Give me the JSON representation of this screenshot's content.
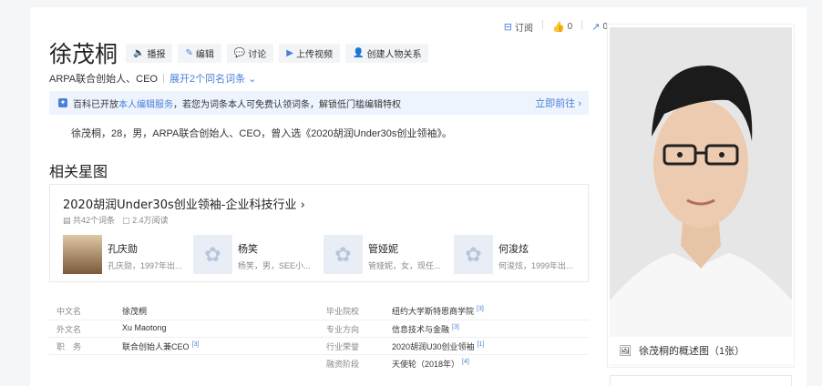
{
  "topbar": {
    "subscribe": "订阅",
    "likes": "0",
    "shares": "0"
  },
  "entry": {
    "title": "徐茂桐",
    "subtitle": "ARPA联合创始人、CEO",
    "more_meanings": "展开2个同名词条"
  },
  "actions": [
    {
      "icon": "speaker-icon",
      "glyph": "🔈",
      "label": "播报"
    },
    {
      "icon": "edit-icon",
      "glyph": "✎",
      "label": "编辑"
    },
    {
      "icon": "discuss-icon",
      "glyph": "💬",
      "label": "讨论"
    },
    {
      "icon": "video-icon",
      "glyph": "▶",
      "label": "上传视频"
    },
    {
      "icon": "relation-icon",
      "glyph": "👤",
      "label": "创建人物关系"
    }
  ],
  "notice": {
    "prefix": "百科已开放",
    "link": "本人编辑服务",
    "text": "，若您为词条本人可免费认领词条，解锁低门槛编辑特权",
    "action": "立即前往 ›"
  },
  "summary": "徐茂桐，28，男，ARPA联合创始人、CEO，曾入选《2020胡润Under30s创业领袖》。",
  "star_section": {
    "heading": "相关星图",
    "title": "2020胡润Under30s创业领袖-企业科技行业 ›",
    "entries": "共42个词条",
    "reads": "2.4万阅读",
    "people": [
      {
        "name": "孔庆勋",
        "desc": "孔庆勋，1997年出...",
        "photo": true
      },
      {
        "name": "杨笑",
        "desc": "杨笑，男，SEE小...",
        "photo": false
      },
      {
        "name": "管娅妮",
        "desc": "管娅妮，女，现任...",
        "photo": false
      },
      {
        "name": "何浚炫",
        "desc": "何浚炫，1999年出...",
        "photo": false
      }
    ]
  },
  "infobox": {
    "left": [
      {
        "label": "中文名",
        "value": "徐茂桐",
        "ref": ""
      },
      {
        "label": "外文名",
        "value": "Xu Maotong",
        "ref": ""
      },
      {
        "label": "职　务",
        "value": "联合创始人兼CEO",
        "ref": "[3]"
      }
    ],
    "right": [
      {
        "label": "毕业院校",
        "value": "纽约大学斯特恩商学院",
        "ref": "[3]"
      },
      {
        "label": "专业方向",
        "value": "信息技术与金融",
        "ref": "[3]"
      },
      {
        "label": "行业荣誉",
        "value": "2020胡润U30创业领袖",
        "ref": "[1]"
      },
      {
        "label": "融资阶段",
        "value": "天使轮（2018年）",
        "ref": "[4]"
      }
    ]
  },
  "photo": {
    "caption": "徐茂桐的概述图（1张）"
  },
  "colors": {
    "accent": "#4a7fd8",
    "notice_bg": "#eef4fe"
  }
}
